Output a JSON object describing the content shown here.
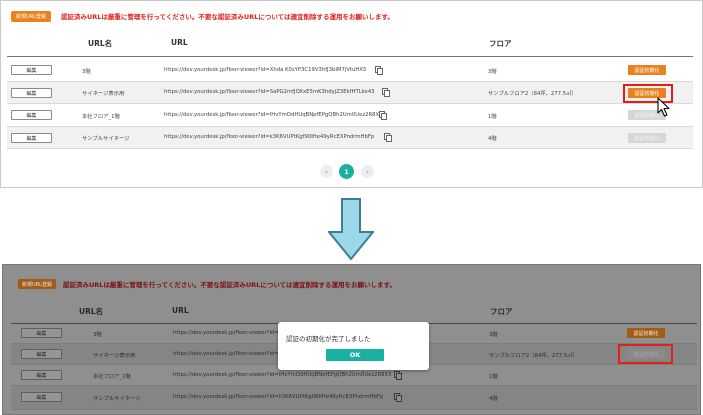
{
  "screen_before": {
    "new_url_button": "新規URL登録",
    "notice": "認証済みURLは厳重に管理を行ってください。不要な認証済みURLについては適宜削除する運用をお願いします。",
    "columns": {
      "name": "URL名",
      "url": "URL",
      "floor": "フロア"
    },
    "rows": [
      {
        "edit": "編集",
        "name": "3階",
        "url": "https://dev.yourdesk.jp/floor-viewer?id=Xhda K0sYP3C19V3hfJ3bIM7jVtuHX5",
        "floor": "3階",
        "auth": "認証初期化",
        "auth_state": "active"
      },
      {
        "edit": "編集",
        "name": "サイネージ表示用",
        "url": "https://dev.yourdesk.jp/floor-viewer?id=SaPG2mfJOXxE5mK3hdyjZ3EkfHTLke43",
        "floor": "サンプルフロア2（84坪、277.5㎡）",
        "auth": "認証初期化",
        "auth_state": "active"
      },
      {
        "edit": "編集",
        "name": "本社フロア_1階",
        "url": "https://dev.yourdesk.jp/floor-viewer?id=IHvYmOdHUqBNpfEPgQBh2Um0Uez2R8X3",
        "floor": "1階",
        "auth": "認証初期化",
        "auth_state": "disabled"
      },
      {
        "edit": "編集",
        "name": "サンプルサイネージ",
        "url": "https://dev.yourdesk.jp/floor-viewer?id=k3K6VUPtKgf90IHe49yRcEXPndrmHbFp",
        "floor": "4階",
        "auth": "認証初期化",
        "auth_state": "disabled"
      }
    ],
    "pagination": {
      "prev": "‹",
      "current": "1",
      "next": "›"
    }
  },
  "screen_after": {
    "new_url_button": "新規URL登録",
    "notice": "認証済みURLは厳重に管理を行ってください。不要な認証済みURLについては適宜削除する運用をお願いします。",
    "columns": {
      "name": "URL名",
      "url": "URL",
      "floor": "フロア"
    },
    "rows": [
      {
        "edit": "編集",
        "name": "3階",
        "url": "https://dev.yourdesk.jp/floor-viewer?id=Xhda",
        "floor": "3階",
        "auth": "認証初期化",
        "auth_state": "active"
      },
      {
        "edit": "編集",
        "name": "サイネージ表示用",
        "url": "https://dev.yourdesk.jp/floor-viewer?id=",
        "floor": "サンプルフロア2（84坪、277.5㎡）",
        "auth": "認証初期化",
        "auth_state": "disabled"
      },
      {
        "edit": "編集",
        "name": "本社フロア_1階",
        "url": "https://dev.yourdesk.jp/floor-viewer?id=IHvYmOdHUqBNpfEPgQBh2Um0Uez2R8X3",
        "floor": "1階",
        "auth": "",
        "auth_state": "hidden"
      },
      {
        "edit": "編集",
        "name": "サンプルサイネージ",
        "url": "https://dev.yourdesk.jp/floor-viewer?id=k3K6VUPtKgf90IHe49yRcEXPndrmHbFp",
        "floor": "4階",
        "auth": "",
        "auth_state": "hidden"
      }
    ],
    "modal": {
      "message": "認証の初期化が完了しました",
      "ok": "OK"
    }
  },
  "colors": {
    "accent_orange": "#e8821e",
    "notice_red": "#e0201b",
    "teal": "#19b0a0",
    "arrow_fill": "#9ad8ea",
    "arrow_stroke": "#3f7e92"
  },
  "icons": [
    "copy-icon",
    "mouse-cursor-icon",
    "chevron-left-icon",
    "chevron-right-icon",
    "down-arrow-icon"
  ]
}
